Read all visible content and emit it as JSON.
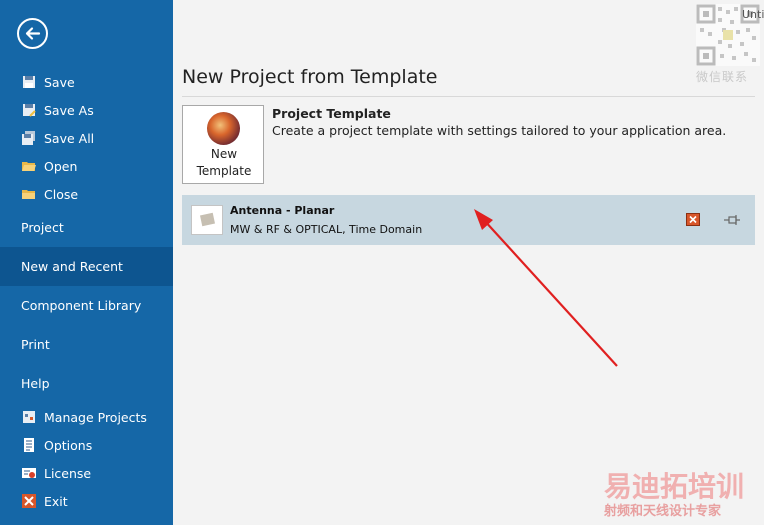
{
  "sidebar": {
    "back_icon": "back-arrow-icon",
    "file_items": [
      {
        "label": "Save",
        "icon": "save-icon"
      },
      {
        "label": "Save As",
        "icon": "save-as-icon"
      },
      {
        "label": "Save All",
        "icon": "save-all-icon"
      },
      {
        "label": "Open",
        "icon": "open-folder-icon"
      },
      {
        "label": "Close",
        "icon": "close-folder-icon"
      }
    ],
    "sections": [
      {
        "label": "Project",
        "active": false
      },
      {
        "label": "New and Recent",
        "active": true
      },
      {
        "label": "Component Library",
        "active": false
      },
      {
        "label": "Print",
        "active": false
      },
      {
        "label": "Help",
        "active": false
      }
    ],
    "bottom_items": [
      {
        "label": "Manage Projects",
        "icon": "manage-projects-icon"
      },
      {
        "label": "Options",
        "icon": "options-icon"
      },
      {
        "label": "License",
        "icon": "license-icon"
      },
      {
        "label": "Exit",
        "icon": "exit-icon"
      }
    ]
  },
  "main": {
    "title": "New Project from Template",
    "new_template": {
      "label_line1": "New",
      "label_line2": "Template"
    },
    "project_template": {
      "title": "Project Template",
      "description": "Create a project template with settings tailored to your application area."
    },
    "recent": [
      {
        "title": "Antenna - Planar",
        "subtitle": "MW & RF & OPTICAL, Time Domain"
      }
    ]
  },
  "overlay": {
    "corner_text": "Unti",
    "qr_caption": "微信联系",
    "watermark_title": "易迪拓培训",
    "watermark_subtitle": "射频和天线设计专家"
  },
  "colors": {
    "sidebar_bg": "#1567a7",
    "sidebar_active": "#0d5590",
    "recent_row_bg": "#c7d7e0",
    "annotation_arrow": "#e02020"
  }
}
